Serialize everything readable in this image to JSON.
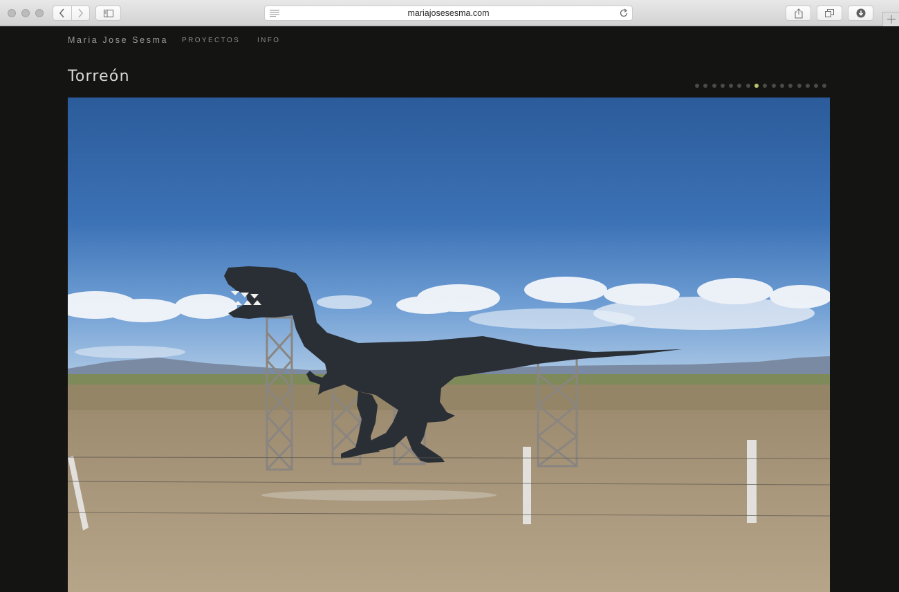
{
  "browser": {
    "url": "mariajosesesma.com",
    "icons": [
      "back-icon",
      "forward-icon",
      "sidebar-icon",
      "reader-icon",
      "reload-icon",
      "share-icon",
      "tabs-icon",
      "downloads-icon",
      "new-tab-icon"
    ]
  },
  "site": {
    "name": "Maria Jose Sesma",
    "nav": [
      "PROYECTOS",
      "INFO"
    ]
  },
  "gallery": {
    "title": "Torreón",
    "slide_count": 16,
    "active_slide": 8,
    "accent_color": "#bcc46a"
  },
  "colors": {
    "page_bg": "#141513",
    "text_muted": "#9b9c98"
  }
}
